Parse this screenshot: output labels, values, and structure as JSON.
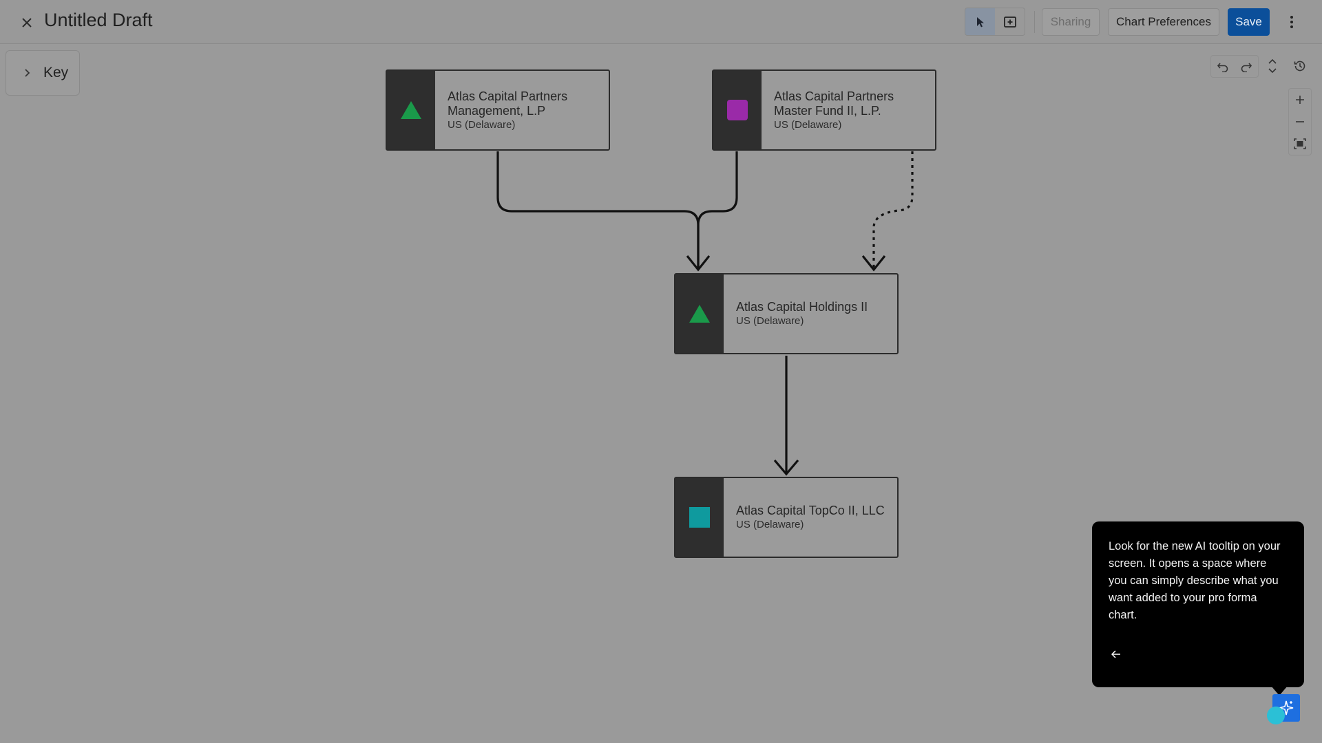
{
  "header": {
    "title": "Untitled Draft",
    "sharing_label": "Sharing",
    "preferences_label": "Chart Preferences",
    "save_label": "Save"
  },
  "key": {
    "label": "Key"
  },
  "nodes": [
    {
      "name": "Atlas Capital Partners Management, L.P",
      "jurisdiction": "US (Delaware)",
      "shape": "triangle",
      "color": "#1a9a4a"
    },
    {
      "name": "Atlas Capital Partners Master Fund II, L.P.",
      "jurisdiction": "US (Delaware)",
      "shape": "rounded-square",
      "color": "#9a2aa8"
    },
    {
      "name": "Atlas Capital Holdings II",
      "jurisdiction": "US (Delaware)",
      "shape": "triangle",
      "color": "#1a9a4a"
    },
    {
      "name": "Atlas Capital TopCo II, LLC",
      "jurisdiction": "US (Delaware)",
      "shape": "square",
      "color": "#0f9a9e"
    }
  ],
  "edges": [
    {
      "from": 0,
      "to": 2,
      "style": "solid"
    },
    {
      "from": 1,
      "to": 2,
      "style": "solid"
    },
    {
      "from": 1,
      "to": 2,
      "style": "dotted"
    },
    {
      "from": 2,
      "to": 3,
      "style": "solid"
    }
  ],
  "tooltip": {
    "message": "Look for the new AI tooltip on your screen. It opens a space where you can simply describe what you want added to your pro forma chart."
  },
  "icons": {
    "close": "close-icon",
    "pointer": "pointer-icon",
    "add_box": "add-box-icon",
    "kebab": "kebab-menu-icon",
    "undo": "undo-icon",
    "redo": "redo-icon",
    "expand": "expand-collapse-icon",
    "history": "history-icon",
    "zoom_in": "plus-icon",
    "zoom_out": "minus-icon",
    "fit": "fit-screen-icon",
    "ai": "sparkle-icon"
  },
  "colors": {
    "save_button": "#0b4f9a",
    "ai_button": "#1e6fe0"
  }
}
